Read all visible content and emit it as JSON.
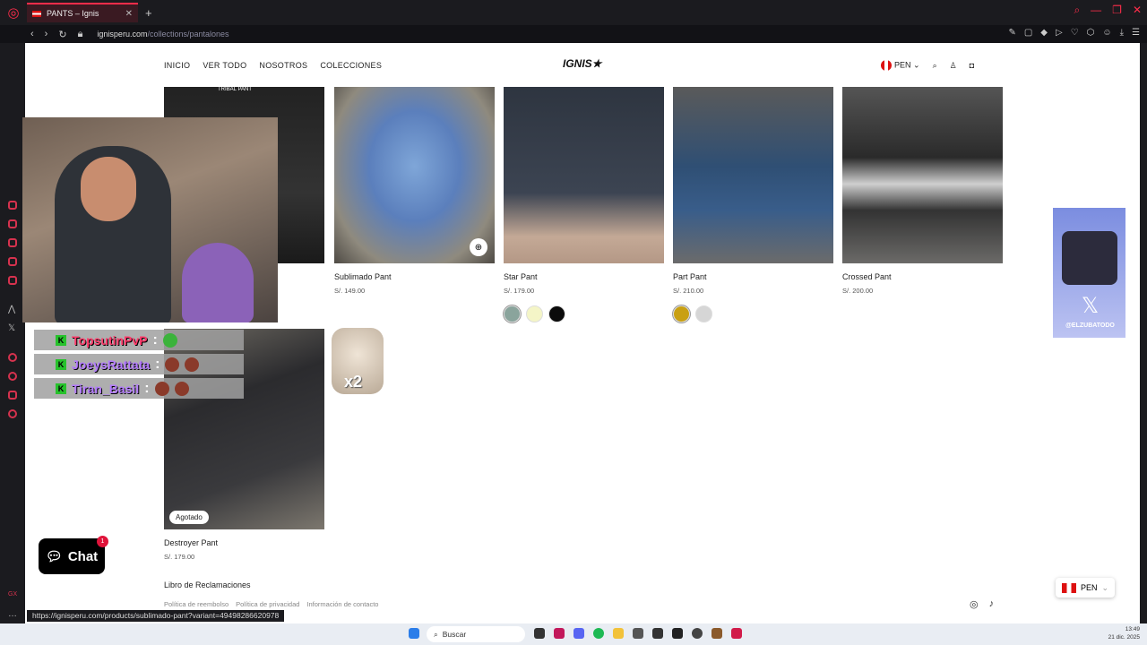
{
  "browser": {
    "tab_title": "PANTS – Ignis",
    "url_host": "ignisperu.com",
    "url_path": "/collections/pantalones",
    "status_url": "https://ignisperu.com/products/sublimado-pant?variant=49498286620978"
  },
  "header": {
    "nav": [
      "INICIO",
      "VER TODO",
      "NOSOTROS",
      "COLECCIONES"
    ],
    "brand": "IGNIS",
    "currency": "PEN"
  },
  "products": [
    {
      "name": "Tribal Pant",
      "price": "",
      "tag": "TRIBAL PANT"
    },
    {
      "name": "Sublimado Pant",
      "price": "S/. 149.00"
    },
    {
      "name": "Star Pant",
      "price": "S/. 179.00",
      "swatches": [
        "#8aa49c",
        "#f4f5c7",
        "#0b0b0b"
      ]
    },
    {
      "name": "Part Pant",
      "price": "S/. 210.00",
      "swatches": [
        "#c9a012",
        "#d6d6d6"
      ]
    },
    {
      "name": "Crossed Pant",
      "price": "S/. 200.00"
    },
    {
      "name": "Destroyer Pant",
      "price": "S/. 179.00",
      "badge": "Agotado"
    }
  ],
  "footer": {
    "title": "Libro de Reclamaciones",
    "links": [
      "Política de reembolso",
      "Política de privacidad",
      "Información de contacto"
    ]
  },
  "chat": {
    "label": "Chat",
    "count": "1"
  },
  "currency_pill": "PEN",
  "stream": {
    "chat": [
      {
        "user": "TopsutinPvP",
        "color": "#ff3b6b"
      },
      {
        "user": "JoeysRattata",
        "color": "#b47bff"
      },
      {
        "user": "Tiran_Basil",
        "color": "#b47bff"
      }
    ],
    "combo": "x2",
    "sticker_tag": "@ELZUBATODO"
  },
  "taskbar": {
    "search": "Buscar",
    "time": "13:49",
    "date": "21 dic. 2025"
  }
}
